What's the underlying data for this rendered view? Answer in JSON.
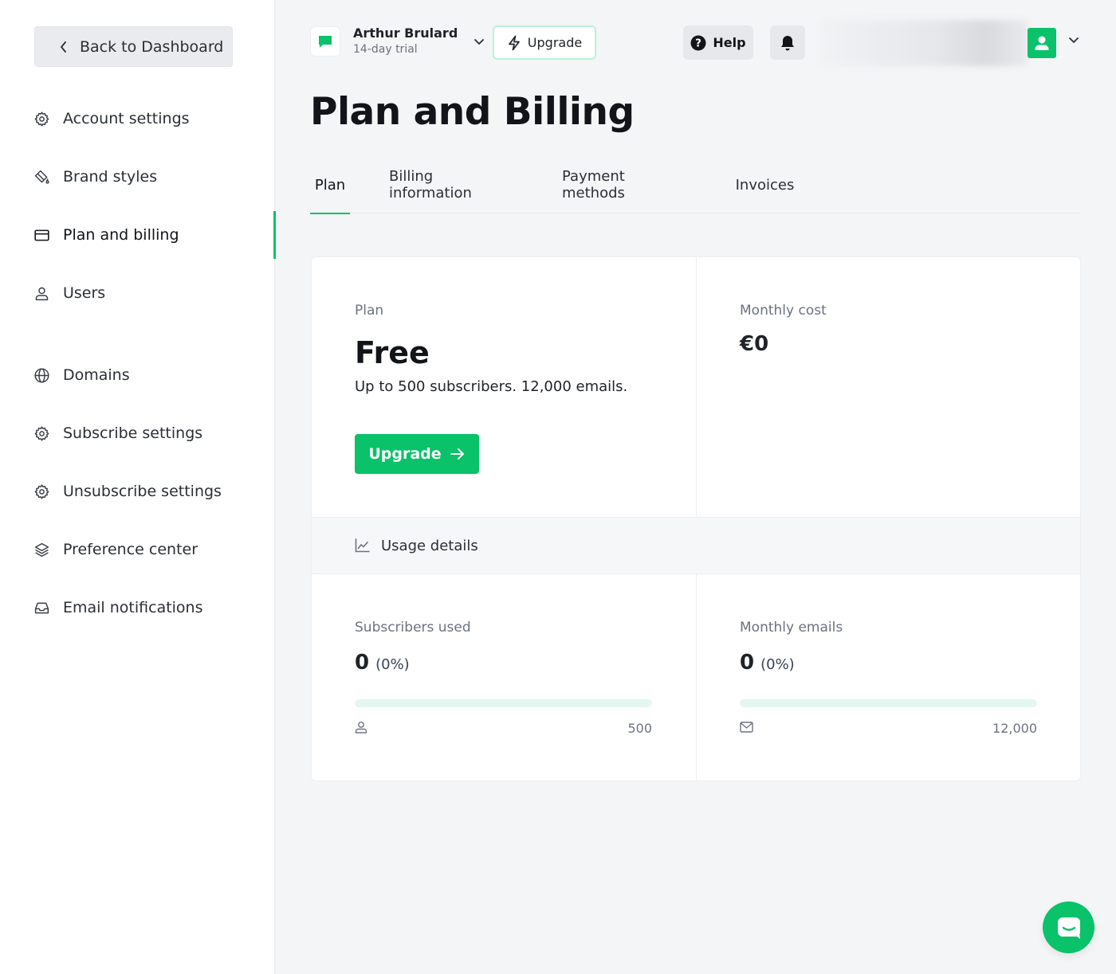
{
  "sidebar": {
    "back_label": "Back to Dashboard",
    "items": [
      {
        "label": "Account settings",
        "icon": "gear-icon"
      },
      {
        "label": "Brand styles",
        "icon": "paint-bucket-icon"
      },
      {
        "label": "Plan and billing",
        "icon": "credit-card-icon",
        "active": true
      },
      {
        "label": "Users",
        "icon": "user-icon"
      },
      {
        "label": "Domains",
        "icon": "globe-icon"
      },
      {
        "label": "Subscribe settings",
        "icon": "gear-icon"
      },
      {
        "label": "Unsubscribe settings",
        "icon": "gear-icon"
      },
      {
        "label": "Preference center",
        "icon": "layers-icon"
      },
      {
        "label": "Email notifications",
        "icon": "inbox-icon"
      }
    ]
  },
  "header": {
    "account_name": "Arthur Brulard",
    "account_sub": "14-day trial",
    "upgrade_label": "Upgrade",
    "help_label": "Help"
  },
  "page": {
    "title": "Plan and Billing"
  },
  "tabs": [
    {
      "label": "Plan",
      "active": true
    },
    {
      "label": "Billing information"
    },
    {
      "label": "Payment methods"
    },
    {
      "label": "Invoices"
    }
  ],
  "plan": {
    "label": "Plan",
    "name": "Free",
    "description": "Up to 500 subscribers. 12,000 emails.",
    "upgrade_label": "Upgrade",
    "cost_label": "Monthly cost",
    "cost_value": "€0"
  },
  "usage": {
    "title": "Usage details",
    "subscribers": {
      "label": "Subscribers used",
      "value": "0",
      "percent": "(0%)",
      "limit": "500",
      "progress": 0
    },
    "emails": {
      "label": "Monthly emails",
      "value": "0",
      "percent": "(0%)",
      "limit": "12,000",
      "progress": 0
    }
  },
  "colors": {
    "accent": "#09c269",
    "progress_track": "#e3f7ee",
    "background": "#f4f5f7"
  }
}
